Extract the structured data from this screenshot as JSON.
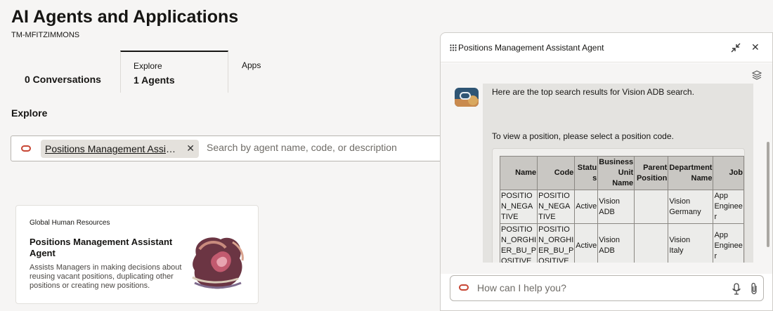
{
  "page": {
    "title": "AI Agents and Applications",
    "subtitle": "TM-MFITZIMMONS"
  },
  "tabs": [
    {
      "label": "",
      "value": "0 Conversations"
    },
    {
      "label": "Explore",
      "value": "1 Agents"
    },
    {
      "label": "Apps",
      "value": ""
    }
  ],
  "explore": {
    "section_title": "Explore",
    "chip_label": "Positions Management Assistant Agent",
    "search_placeholder": "Search by agent name, code, or description"
  },
  "card": {
    "category": "Global Human Resources",
    "title": "Positions Management Assistant Agent",
    "description": "Assists Managers in making decisions about reusing vacant positions, duplicating other positions or creating new positions."
  },
  "chat": {
    "title": "Positions Management Assistant Agent",
    "message_line1": "Here are the top search results for Vision ADB search.",
    "message_line2": "To view a position, please select a position code.",
    "table": {
      "headers": [
        "Name",
        "Code",
        "Status",
        "Business Unit Name",
        "Parent Position",
        "Department Name",
        "Job"
      ],
      "rows": [
        [
          "POSITIO\nN_NEGA\nTIVE",
          "POSITIO\nN_NEGA\nTIVE",
          "Active",
          "Vision\nADB",
          "",
          "Vision\nGermany",
          "App\nEnginee\nr"
        ],
        [
          "POSITIO\nN_ORGHI\nER_BU_P\nOSITIVE",
          "POSITIO\nN_ORGHI\nER_BU_P\nOSITIVE",
          "Active",
          "Vision\nADB",
          "",
          "Vision\nItaly",
          "App\nEnginee\nr"
        ]
      ]
    },
    "composer_placeholder": "How can I help you?"
  },
  "colors": {
    "accent": "#c74634",
    "background": "#f6f5f4"
  },
  "icons": [
    "oracle-logo-icon",
    "close-icon",
    "grid-icon",
    "minimize-icon",
    "layers-icon",
    "mic-icon",
    "paperclip-icon"
  ]
}
